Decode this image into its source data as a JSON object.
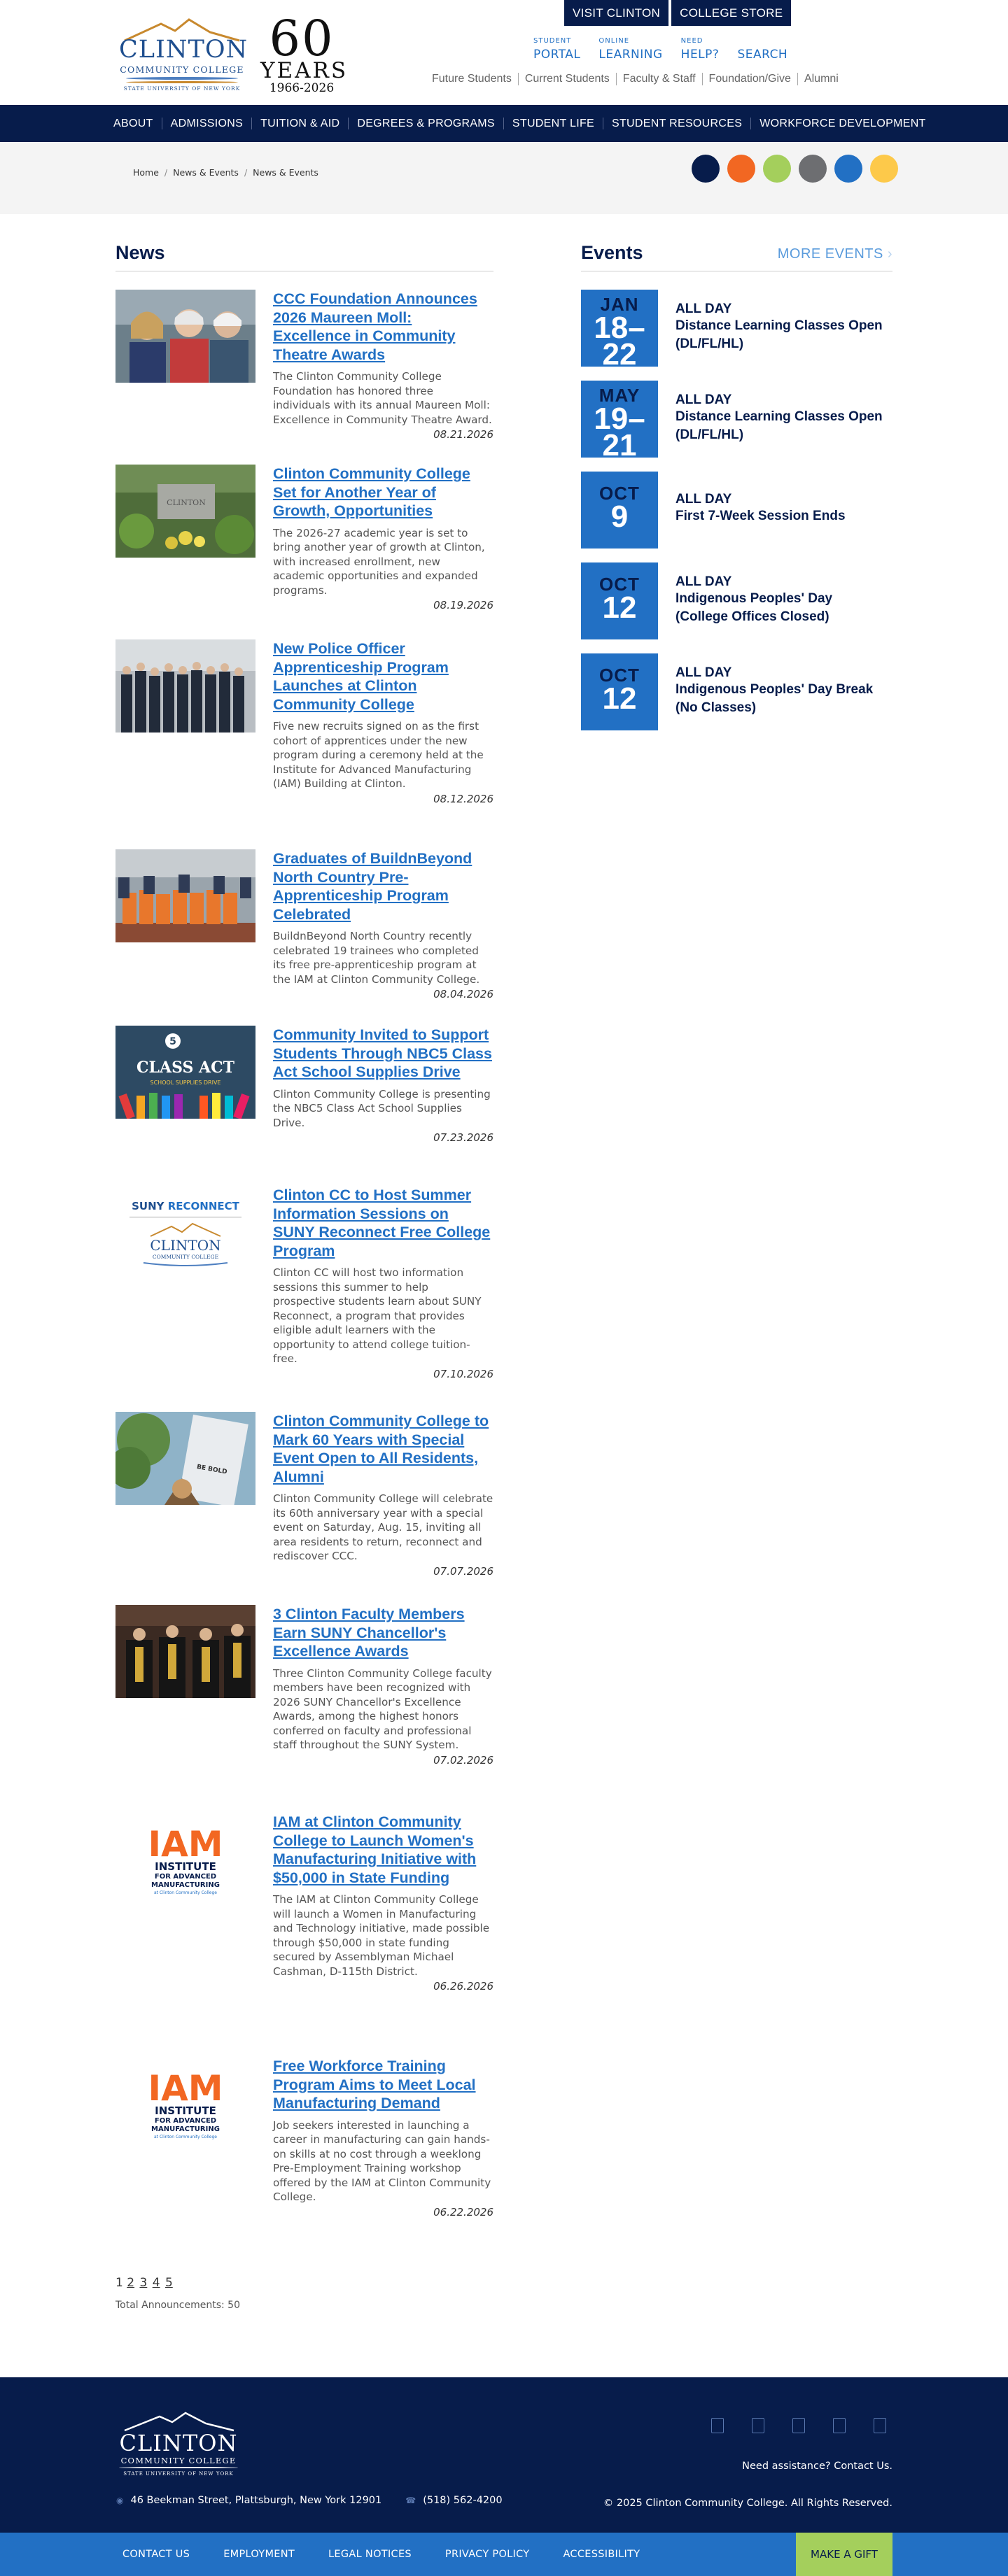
{
  "header": {
    "logo": {
      "name": "CLINTON",
      "sub": "COMMUNITY COLLEGE",
      "suny": "STATE UNIVERSITY OF NEW YORK"
    },
    "anniversary": {
      "number": "60",
      "word": "YEARS",
      "dates": "1966-2026"
    },
    "top_buttons": [
      "VISIT CLINTON",
      "COLLEGE STORE"
    ],
    "quick_links": [
      {
        "small": "STUDENT",
        "big": "PORTAL"
      },
      {
        "small": "ONLINE",
        "big": "LEARNING"
      },
      {
        "small": "NEED",
        "big": "HELP?"
      },
      {
        "small": "",
        "big": "SEARCH"
      }
    ],
    "audience_links": [
      "Future Students",
      "Current Students",
      "Faculty & Staff",
      "Foundation/Give",
      "Alumni"
    ]
  },
  "main_nav": [
    "ABOUT",
    "ADMISSIONS",
    "TUITION & AID",
    "DEGREES & PROGRAMS",
    "STUDENT LIFE",
    "STUDENT RESOURCES",
    "WORKFORCE DEVELOPMENT"
  ],
  "breadcrumb": [
    "Home",
    "News & Events",
    "News & Events"
  ],
  "swatch_colors": [
    "#071c4b",
    "#f26722",
    "#a4cf5c",
    "#6d6e71",
    "#2270c4",
    "#fdc94a"
  ],
  "news": {
    "heading": "News",
    "items": [
      {
        "title": "CCC Foundation Announces 2026 Maureen Moll: Excellence in Community Theatre Awards",
        "summary": "The Clinton Community College Foundation has honored three individuals with its annual Maureen Moll: Excellence in Community Theatre Award.",
        "date": "08.21.2026",
        "image": "three-people-photo"
      },
      {
        "title": "Clinton Community College Set for Another Year of Growth, Opportunities",
        "summary": "The 2026-27 academic year is set to bring another year of growth at Clinton, with increased enrollment, new academic opportunities and expanded programs.",
        "date": "08.19.2026",
        "image": "campus-sign-photo"
      },
      {
        "title": "New Police Officer Apprenticeship Program Launches at Clinton Community College",
        "summary": "Five new recruits signed on as the first cohort of apprentices under the new program during a ceremony held at the Institute for Advanced Manufacturing (IAM) Building at Clinton.",
        "date": "08.12.2026",
        "image": "police-group-photo"
      },
      {
        "title": "Graduates of BuildnBeyond North Country Pre-Apprenticeship Program Celebrated",
        "summary": "BuildnBeyond North Country recently celebrated 19 trainees who completed its free pre-apprenticeship program at the IAM at Clinton Community College.",
        "date": "08.04.2026",
        "image": "graduates-group-photo"
      },
      {
        "title": "Community Invited to Support Students Through NBC5 Class Act School Supplies Drive",
        "summary": "Clinton Community College is presenting the NBC5 Class Act School Supplies Drive.",
        "date": "07.23.2026",
        "image": "class-act-graphic"
      },
      {
        "title": "Clinton CC to Host Summer Information Sessions on SUNY Reconnect Free College Program",
        "summary": "Clinton CC will host two information sessions this summer to help prospective students learn about SUNY Reconnect, a program that provides eligible adult learners with the opportunity to attend college tuition-free.",
        "date": "07.10.2026",
        "image": "suny-reconnect-logo"
      },
      {
        "title": "Clinton Community College to Mark 60 Years with Special Event Open to All Residents, Alumni",
        "summary": "Clinton Community College will celebrate its 60th anniversary year with a special event on Saturday, Aug. 15, inviting all area residents to return, reconnect and rediscover CCC.",
        "date": "07.07.2026",
        "image": "mascot-sign-photo"
      },
      {
        "title": "3 Clinton Faculty Members Earn SUNY Chancellor's Excellence Awards",
        "summary": "Three Clinton Community College faculty members have been recognized with 2026 SUNY Chancellor's Excellence Awards, among the highest honors conferred on faculty and professional staff throughout the SUNY System.",
        "date": "07.02.2026",
        "image": "faculty-regalia-photo"
      },
      {
        "title": "IAM at Clinton Community College to Launch Women's Manufacturing Initiative with $50,000 in State Funding",
        "summary": "The IAM at Clinton Community College will launch a Women in Manufacturing and Technology initiative, made possible through $50,000 in state funding secured by Assemblyman Michael Cashman, D-115th District.",
        "date": "06.26.2026",
        "image": "iam-logo"
      },
      {
        "title": "Free Workforce Training Program Aims to Meet Local Manufacturing Demand",
        "summary": "Job seekers interested in launching a career in manufacturing can gain hands-on skills at no cost through a weeklong Pre-Employment Training workshop offered by the IAM at Clinton Community College.",
        "date": "06.22.2026",
        "image": "iam-logo"
      }
    ],
    "pager": [
      "1",
      "2",
      "3",
      "4",
      "5"
    ],
    "total": "Total Announcements: 50",
    "class_act": {
      "nbc": "5",
      "line1": "CLASS ACT",
      "line2": "SCHOOL SUPPLIES DRIVE"
    },
    "suny_reconnect": {
      "a": "SUNY ",
      "b": "RECONNECT"
    },
    "iam": {
      "letters": "IAM",
      "line1": "INSTITUTE",
      "line2": "FOR ADVANCED",
      "line3": "MANUFACTURING",
      "line4": "at Clinton Community College"
    },
    "mascot_sign": "BE BOLD",
    "campus_sign": "CLINTON"
  },
  "events": {
    "heading": "Events",
    "more": "MORE EVENTS",
    "items": [
      {
        "month": "JAN",
        "day": "18–22",
        "time": "ALL DAY",
        "title": "Distance Learning Classes Open (DL/FL/HL)"
      },
      {
        "month": "MAY",
        "day": "19–21",
        "time": "ALL DAY",
        "title": "Distance Learning Classes Open (DL/FL/HL)"
      },
      {
        "month": "OCT",
        "day": "9",
        "time": "ALL DAY",
        "title": "First 7-Week Session Ends"
      },
      {
        "month": "OCT",
        "day": "12",
        "time": "ALL DAY",
        "title": "Indigenous Peoples' Day (College Offices Closed)"
      },
      {
        "month": "OCT",
        "day": "12",
        "time": "ALL DAY",
        "title": "Indigenous Peoples' Day Break (No Classes)"
      }
    ]
  },
  "footer": {
    "address": "46 Beekman Street, Plattsburgh, New York 12901",
    "phone": "(518) 562-4200",
    "assist": "Need assistance? Contact Us.",
    "copyright": "© 2025 Clinton Community College. All Rights Reserved.",
    "social_icons": [
      "facebook-icon",
      "twitter-icon",
      "instagram-icon",
      "linkedin-icon",
      "youtube-icon"
    ],
    "bottom_links": [
      "CONTACT US",
      "EMPLOYMENT",
      "LEGAL NOTICES",
      "PRIVACY POLICY",
      "ACCESSIBILITY"
    ],
    "gift": "MAKE A GIFT"
  }
}
